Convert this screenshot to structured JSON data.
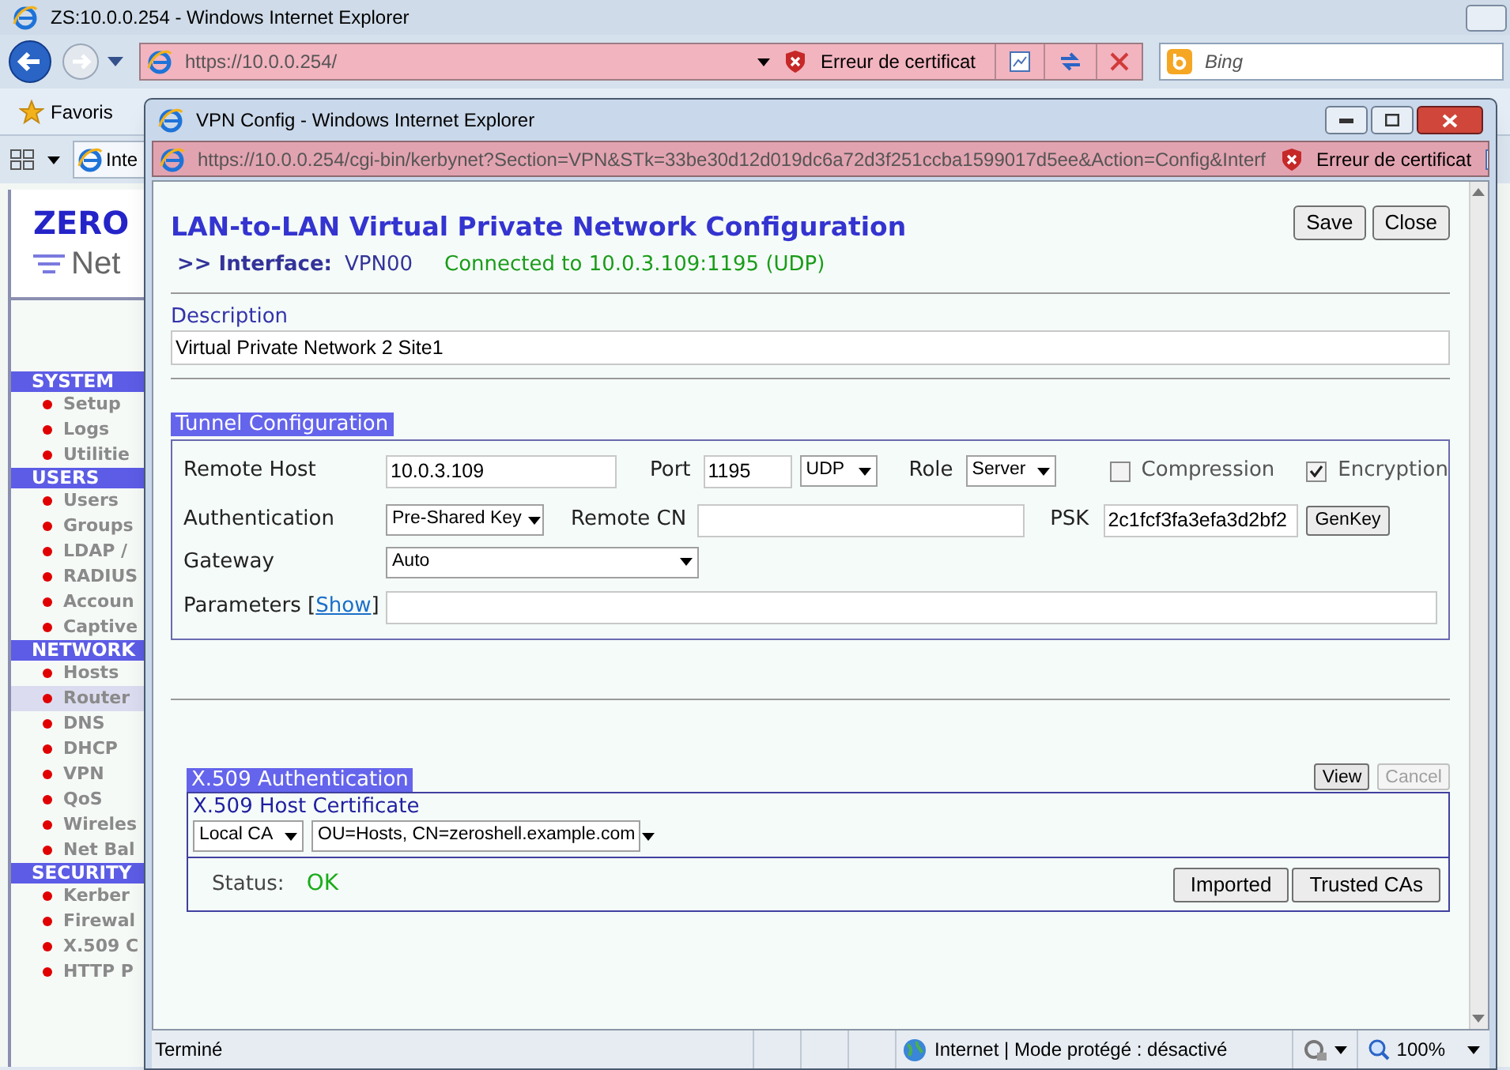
{
  "browser": {
    "title": "ZS:10.0.0.254 - Windows Internet Explorer",
    "url_host": "https://10.0.0.254/",
    "cert_error": "Erreur de certificat",
    "search_placeholder": "Bing",
    "favorites": "Favoris",
    "tab": "Inte"
  },
  "sidebar": {
    "logo_top": "ZERO",
    "logo_bottom": "Net",
    "sections": [
      {
        "title": "SYSTEM",
        "items": [
          {
            "label": "Setup",
            "selected": false
          },
          {
            "label": "Logs",
            "selected": false
          },
          {
            "label": "Utilitie",
            "selected": false
          }
        ]
      },
      {
        "title": "USERS",
        "items": [
          {
            "label": "Users",
            "selected": false
          },
          {
            "label": "Groups",
            "selected": false
          },
          {
            "label": "LDAP /",
            "selected": false
          },
          {
            "label": "RADIUS",
            "selected": false
          },
          {
            "label": "Accoun",
            "selected": false
          },
          {
            "label": "Captive",
            "selected": false
          }
        ]
      },
      {
        "title": "NETWORK",
        "items": [
          {
            "label": "Hosts",
            "selected": false
          },
          {
            "label": "Router",
            "selected": true
          },
          {
            "label": "DNS",
            "selected": false
          },
          {
            "label": "DHCP",
            "selected": false
          },
          {
            "label": "VPN",
            "selected": false
          },
          {
            "label": "QoS",
            "selected": false
          },
          {
            "label": "Wireles",
            "selected": false
          },
          {
            "label": "Net Bal",
            "selected": false
          }
        ]
      },
      {
        "title": "SECURITY",
        "items": [
          {
            "label": "Kerber",
            "selected": false
          },
          {
            "label": "Firewal",
            "selected": false
          },
          {
            "label": "X.509 C",
            "selected": false
          },
          {
            "label": "HTTP P",
            "selected": false
          }
        ]
      }
    ]
  },
  "popup": {
    "title": "VPN Config - Windows Internet Explorer",
    "url": "https://10.0.0.254/cgi-bin/kerbynet?Section=VPN&STk=33be30d12d019dc6a72d3f251ccba1599017d5ee&Action=Config&Interf",
    "cert_error": "Erreur de certificat",
    "heading": "LAN-to-LAN Virtual Private Network Configuration",
    "interface_label": ">> Interface:",
    "interface_name": "VPN00",
    "connection_status": "Connected to 10.0.3.109:1195 (UDP)",
    "buttons": [
      "Save",
      "Close"
    ],
    "description": {
      "label": "Description",
      "value": "Virtual Private Network 2 Site1"
    },
    "tunnel": {
      "title": "Tunnel Configuration",
      "remote_host_label": "Remote Host",
      "remote_host": "10.0.3.109",
      "port_label": "Port",
      "port": "1195",
      "protocol": "UDP",
      "role_label": "Role",
      "role": "Server",
      "compression": {
        "label": "Compression",
        "checked": false
      },
      "encryption": {
        "label": "Encryption",
        "checked": true
      },
      "auth_label": "Authentication",
      "auth": "Pre-Shared Key",
      "remote_cn_label": "Remote CN",
      "psk_label": "PSK",
      "psk": "2c1fcf3fa3efa3d2bf2",
      "genkey": "GenKey",
      "gateway_label": "Gateway",
      "gateway": "Auto",
      "parameters_label": "Parameters [",
      "show_link": "Show",
      "parameters_close": "]"
    },
    "x509": {
      "title": "X.509 Authentication",
      "view": {
        "label": "View",
        "disabled": false
      },
      "cancel": {
        "label": "Cancel",
        "disabled": true
      },
      "cert_title": "X.509 Host Certificate",
      "ca": "Local CA",
      "cert": "OU=Hosts, CN=zeroshell.example.com",
      "status_label": "Status:",
      "status": "OK",
      "buttons": [
        "Imported",
        "Trusted CAs"
      ]
    }
  },
  "status_bar": {
    "text": "Terminé",
    "zone": "Internet | Mode protégé : désactivé",
    "zoom": "100%"
  }
}
